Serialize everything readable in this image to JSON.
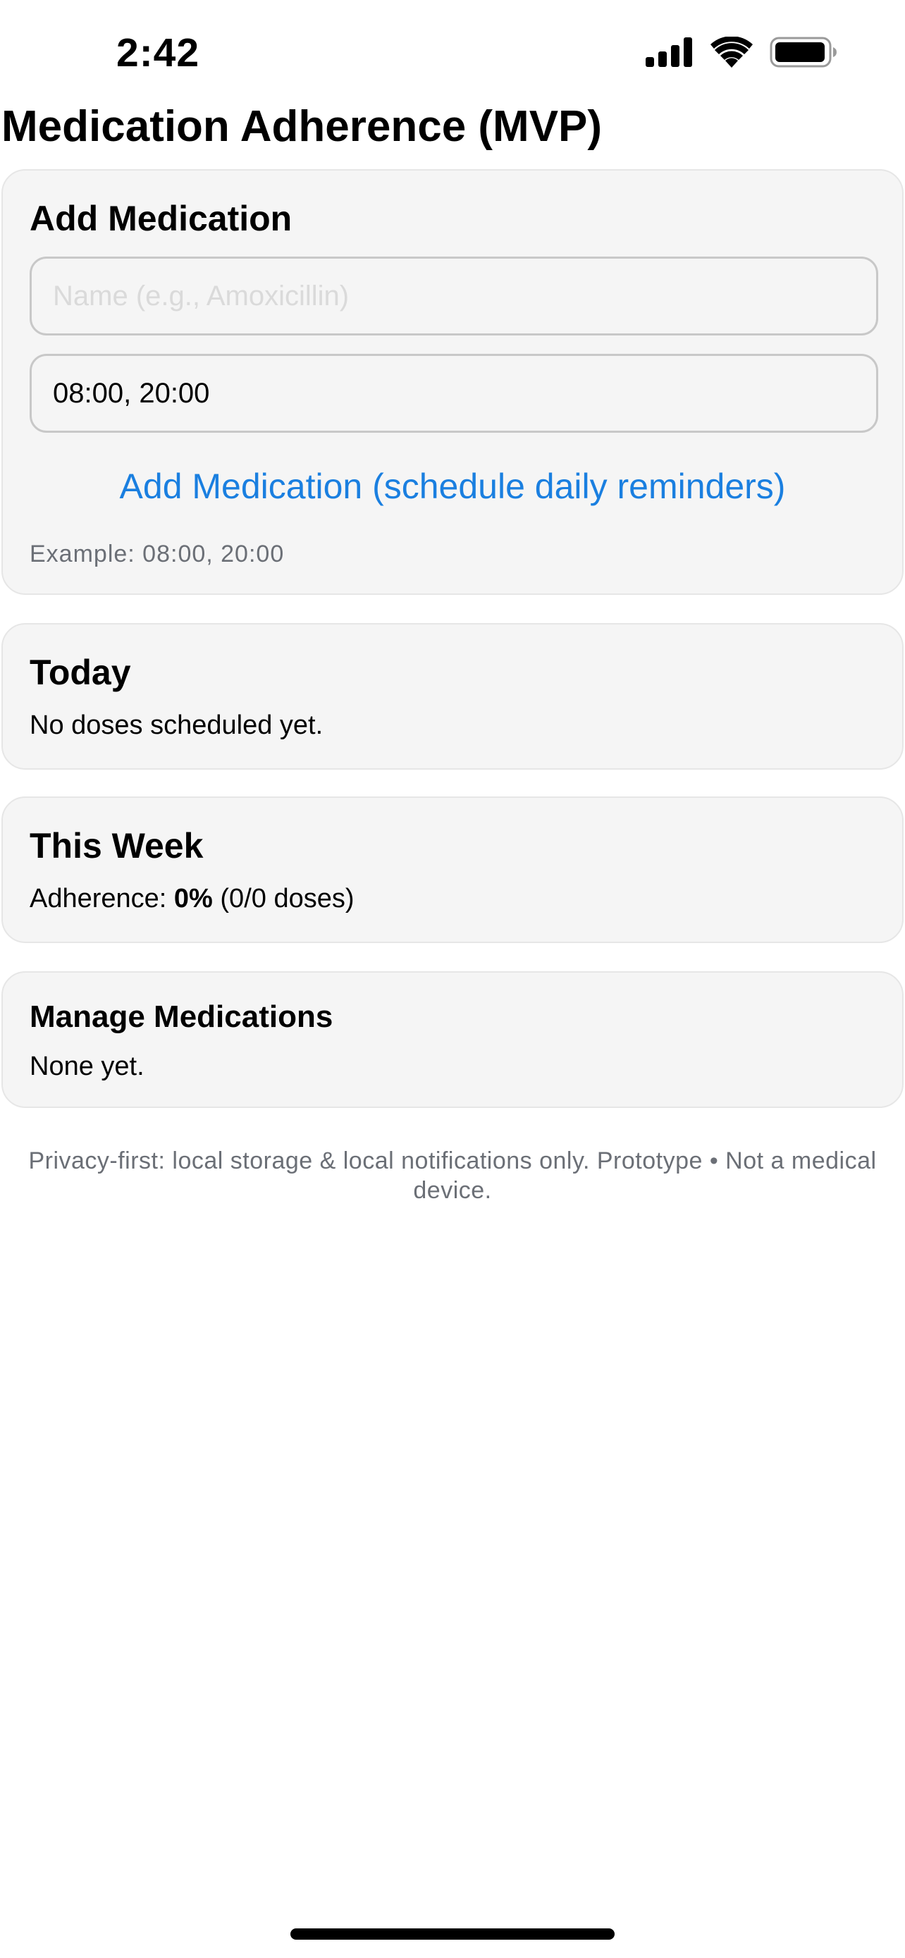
{
  "status_bar": {
    "time": "2:42",
    "icons": [
      "cellular-signal-icon",
      "wifi-icon",
      "battery-icon"
    ]
  },
  "page": {
    "title": "Medication Adherence (MVP)"
  },
  "add_medication": {
    "title": "Add Medication",
    "name_placeholder": "Name (e.g., Amoxicillin)",
    "name_value": "",
    "times_value": "08:00, 20:00",
    "add_button_label": "Add Medication (schedule daily reminders)",
    "hint": "Example: 08:00, 20:00"
  },
  "today": {
    "title": "Today",
    "message": "No doses scheduled yet."
  },
  "this_week": {
    "title": "This Week",
    "adherence_label": "Adherence: ",
    "adherence_percent": "0%",
    "adherence_detail": " (0/0 doses)"
  },
  "manage": {
    "title": "Manage Medications",
    "message": "None yet."
  },
  "footer": {
    "text": "Privacy-first: local storage & local notifications only. Prototype • Not a medical device."
  },
  "colors": {
    "accent": "#1a7fe0",
    "card_background": "#f5f5f5",
    "muted_text": "#6b6f76"
  }
}
